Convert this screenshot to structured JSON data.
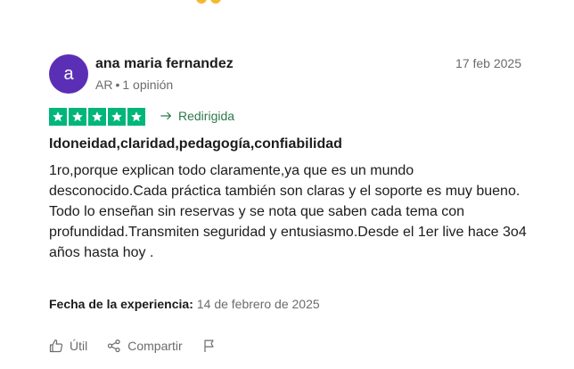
{
  "review": {
    "avatar_initial": "a",
    "author_name": "ana maria fernandez",
    "country": "AR",
    "opinions": "1 opinión",
    "date": "17 feb 2025",
    "rating": 5,
    "rating_max": 5,
    "redirect_label": "Redirigida",
    "title": "Idoneidad,claridad,pedagogía,confiabilidad",
    "body_paragraphs": [
      "1ro,porque explican todo claramente,ya que es un mundo desconocido.Cada práctica también son claras y el soporte es muy bueno.",
      "Todo lo enseñan sin reservas y se nota que saben cada tema con profundidad.Transmiten seguridad y entusiasmo.Desde el 1er live hace 3o4 años hasta hoy ."
    ],
    "experience_label": "Fecha de la experiencia:",
    "experience_date": "14 de febrero de 2025"
  },
  "actions": {
    "useful_label": "Útil",
    "share_label": "Compartir"
  },
  "colors": {
    "avatar_bg": "#5a2fb5",
    "star_green": "#00b67a",
    "redirect_green": "#2c7a4b",
    "muted_text": "#6b6b6b"
  },
  "icons": {
    "star": "star-icon",
    "redirect": "arrow-right-icon",
    "useful": "thumbs-up-icon",
    "share": "share-icon",
    "report": "flag-icon"
  }
}
